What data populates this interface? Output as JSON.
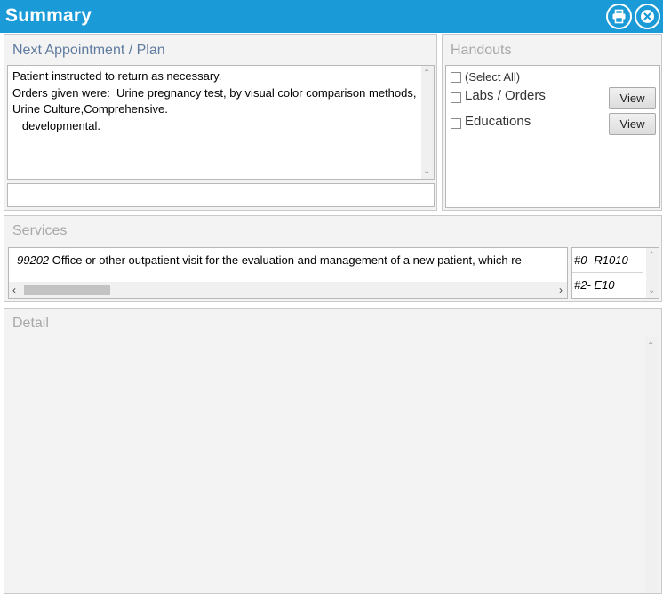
{
  "window": {
    "title": "Summary",
    "accent_color": "#1a9bd7",
    "buttons": [
      {
        "name": "print",
        "icon": "printer-icon"
      },
      {
        "name": "close",
        "icon": "close-icon"
      }
    ]
  },
  "plan": {
    "title": "Next Appointment / Plan",
    "notes": "Patient instructed to return as necessary.\nOrders given were:  Urine pregnancy test, by visual color comparison methods, Urine Culture,Comprehensive.\n   developmental.",
    "input_value": ""
  },
  "handouts": {
    "title": "Handouts",
    "select_all_label": "(Select All)",
    "items": [
      {
        "label": "Labs / Orders",
        "button_label": "View",
        "checked": false
      },
      {
        "label": "Educations",
        "button_label": "View",
        "checked": false
      }
    ]
  },
  "services": {
    "title": "Services",
    "row": {
      "code": "99202",
      "description": "Office or other outpatient visit for the evaluation and management of a new patient, which re"
    },
    "diagnoses": [
      "#0- R1010",
      "#2- E10"
    ]
  },
  "detail": {
    "title": "Detail"
  }
}
